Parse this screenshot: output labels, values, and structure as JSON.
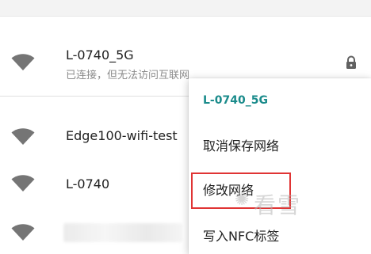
{
  "networks": [
    {
      "ssid": "L-0740_5G",
      "status": "已连接，但无法访问互联网",
      "secured": true,
      "icon": "wifi-signal-icon"
    },
    {
      "ssid": "Edge100-wifi-test",
      "icon": "wifi-signal-icon"
    },
    {
      "ssid": "L-0740",
      "icon": "wifi-signal-icon"
    },
    {
      "ssid": "",
      "icon": "wifi-signal-icon"
    }
  ],
  "popup": {
    "title": "L-0740_5G",
    "items": [
      {
        "label": "取消保存网络"
      },
      {
        "label": "修改网络"
      },
      {
        "label": "写入NFC标签"
      }
    ]
  },
  "watermark": {
    "text": "看雪",
    "mark": "✺"
  },
  "colors": {
    "accent": "#1a8b8b",
    "highlight": "#e03434",
    "icon": "#757575"
  }
}
